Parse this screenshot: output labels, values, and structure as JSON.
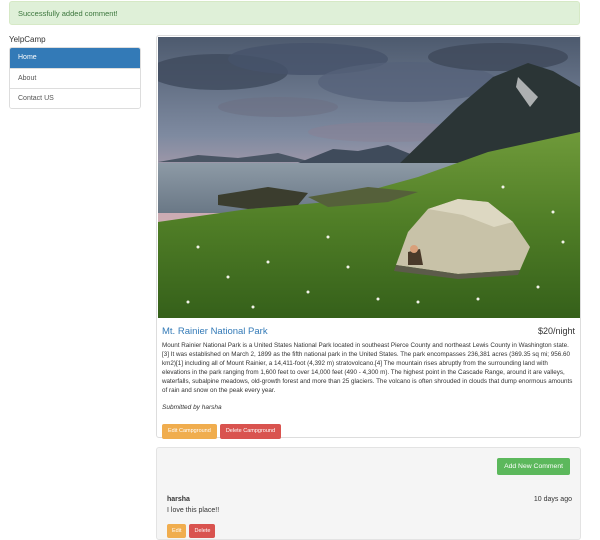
{
  "flash": {
    "message": "Successfully added comment!"
  },
  "sidebar": {
    "brand": "YelpCamp",
    "items": [
      {
        "label": "Home",
        "active": true
      },
      {
        "label": "About",
        "active": false
      },
      {
        "label": "Contact US",
        "active": false
      }
    ]
  },
  "campground": {
    "name": "Mt. Rainier National Park",
    "price": "$20/night",
    "description": "Mount Rainier National Park is a United States National Park located in southeast Pierce County and northeast Lewis County in Washington state.[3] It was established on March 2, 1899 as the fifth national park in the United States. The park encompasses 236,381 acres (369.35 sq mi; 956.60 km2)[1] including all of Mount Rainier, a 14,411-foot (4,392 m) stratovolcano.[4] The mountain rises abruptly from the surrounding land with elevations in the park ranging from 1,600 feet to over 14,000 feet (490 - 4,300 m). The highest point in the Cascade Range, around it are valleys, waterfalls, subalpine meadows, old-growth forest and more than 25 glaciers. The volcano is often shrouded in clouds that dump enormous amounts of rain and snow on the peak every year.",
    "submitted_by": "Submitted by harsha",
    "edit_label": "Edit Campground",
    "delete_label": "Delete Campground"
  },
  "comments_section": {
    "add_label": "Add New Comment",
    "comments": [
      {
        "author": "harsha",
        "time": "10 days ago",
        "text": "I love this place!!",
        "edit_label": "Edit",
        "delete_label": "Delete"
      }
    ]
  },
  "colors": {
    "primary": "#337ab7",
    "success": "#5cb85c",
    "warning": "#f0ad4e",
    "danger": "#d9534f",
    "alert_bg": "#dff0d8",
    "alert_text": "#3c763d"
  }
}
